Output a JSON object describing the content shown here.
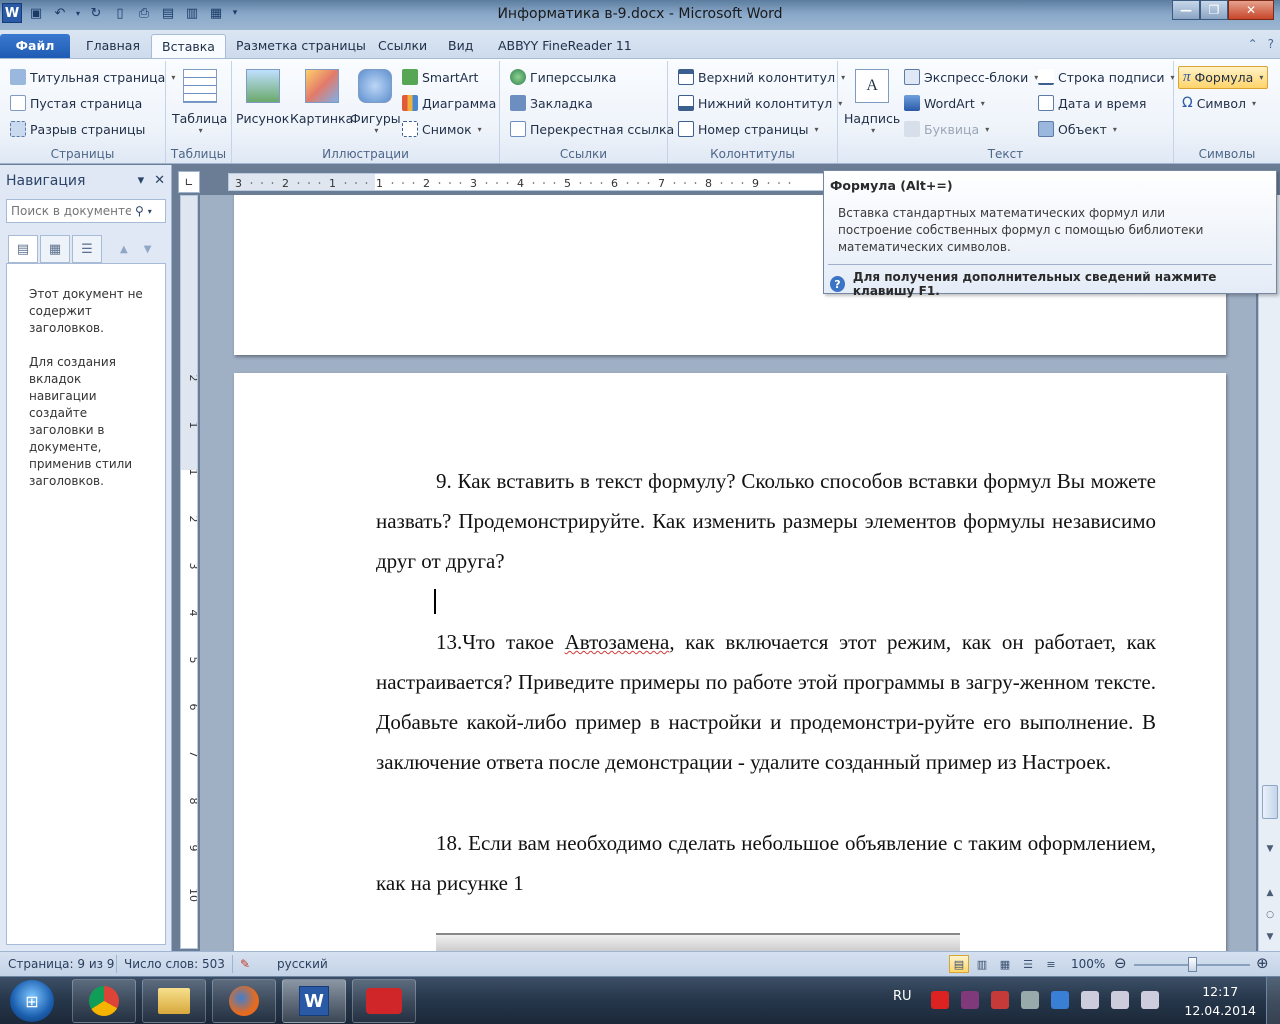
{
  "window": {
    "title": "Информатика в-9.docx  -  Microsoft Word",
    "app_logo": "W",
    "accent_color": "#2a5aa5"
  },
  "tabs": [
    "Файл",
    "Главная",
    "Вставка",
    "Разметка страницы",
    "Ссылки",
    "Вид",
    "ABBYY FineReader 11"
  ],
  "active_tab": "Вставка",
  "ribbon": {
    "pages": {
      "label": "Страницы",
      "items": [
        "Титульная страница",
        "Пустая страница",
        "Разрыв страницы"
      ]
    },
    "tables": {
      "label": "Таблицы",
      "button": "Таблица"
    },
    "illustrations": {
      "label": "Иллюстрации",
      "buttons": [
        "Рисунок",
        "Картинка",
        "Фигуры"
      ],
      "items": [
        "SmartArt",
        "Диаграмма",
        "Снимок"
      ]
    },
    "links": {
      "label": "Ссылки",
      "items": [
        "Гиперссылка",
        "Закладка",
        "Перекрестная ссылка"
      ]
    },
    "headers": {
      "label": "Колонтитулы",
      "items": [
        "Верхний колонтитул",
        "Нижний колонтитул",
        "Номер страницы"
      ]
    },
    "text": {
      "label": "Текст",
      "button": "Надпись",
      "items": [
        "Экспресс-блоки",
        "WordArt",
        "Буквица",
        "Строка подписи",
        "Дата и время",
        "Объект"
      ]
    },
    "symbols": {
      "label": "Символы",
      "items": [
        "Формула",
        "Символ"
      ]
    }
  },
  "navigation": {
    "title": "Навигация",
    "search_placeholder": "Поиск в документе",
    "message_1": "Этот документ не содержит заголовков.",
    "message_2": "Для создания вкладок навигации создайте заголовки в документе, применив стили заголовков."
  },
  "tooltip": {
    "title": "Формула (Alt+=)",
    "body": "Вставка стандартных математических формул или построение собственных формул с помощью библиотеки математических символов.",
    "help": "Для получения дополнительных сведений нажмите клавишу F1."
  },
  "ruler": {
    "h_ticks": [
      "3",
      "2",
      "1",
      "1",
      "2",
      "3",
      "4",
      "5",
      "6",
      "7",
      "8",
      "9"
    ],
    "v_ticks": [
      "2",
      "1",
      "1",
      "2",
      "3",
      "4",
      "5",
      "6",
      "7",
      "8",
      "9",
      "10"
    ]
  },
  "document": {
    "p9": "9. Как вставить в текст формулу? Сколько способов вставки формул Вы можете назвать? Продемонстрируйте. Как изменить размеры элементов формулы независимо друг от друга?",
    "p13_a": "13.Что такое ",
    "p13_b": "Автозамена",
    "p13_c": ", как включается этот режим, как он работает, как настраивается? Приведите примеры по работе этой программы в загру-женном тексте. Добавьте какой-либо пример в настройки и продемонстри-руйте его выполнение. В заключение ответа после демонстрации - удалите созданный пример из Настроек.",
    "p18": "18. Если вам необходимо сделать небольшое объявление с таким оформлением, как на рисунке 1"
  },
  "status": {
    "page": "Страница: 9 из 9",
    "words": "Число слов: 503",
    "language": "русский",
    "zoom": "100%",
    "zoom_percent": 100
  },
  "taskbar": {
    "apps": [
      "chrome",
      "explorer",
      "firefox",
      "word",
      "screen-recorder"
    ],
    "active_app": "word",
    "lang": "RU",
    "time": "12:17",
    "date": "12.04.2014"
  }
}
